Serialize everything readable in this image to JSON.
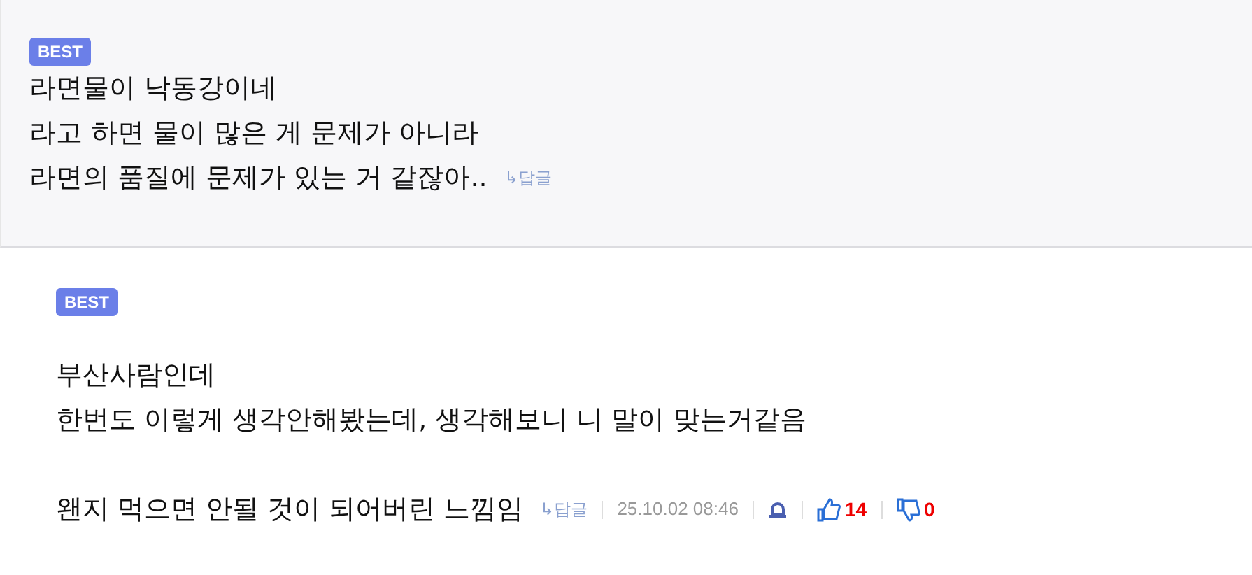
{
  "comments": [
    {
      "badge": "BEST",
      "paragraphs": [
        [
          "라면물이 낙동강이네",
          "라고 하면 물이 많은 게 문제가 아니라",
          "라면의 품질에 문제가 있는 거 같잖아.."
        ]
      ],
      "reply": "↳답글"
    },
    {
      "badge": "BEST",
      "paragraphs": [
        [
          "부산사람인데",
          "한번도 이렇게 생각안해봤는데, 생각해보니 니 말이 맞는거같음"
        ],
        [
          "왠지 먹으면 안될 것이 되어버린 느낌임"
        ]
      ],
      "reply": "↳답글",
      "date": "25.10.02 08:46",
      "likes": "14",
      "dislikes": "0"
    }
  ]
}
